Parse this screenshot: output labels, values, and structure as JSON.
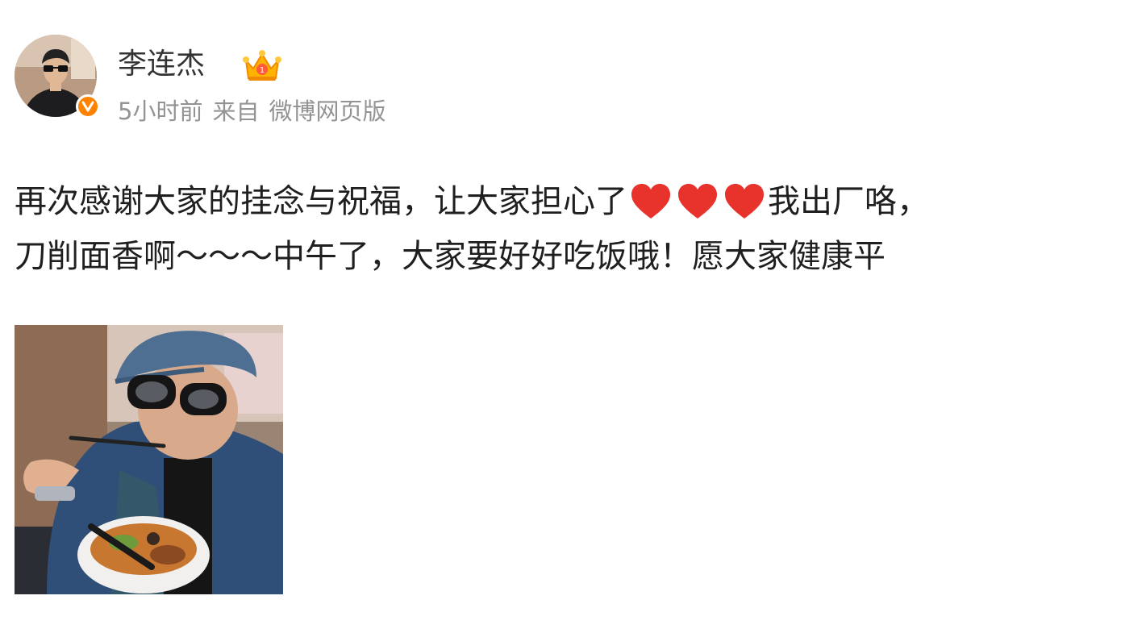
{
  "author": {
    "name": "李连杰",
    "avatar_icon": "avatar-portrait",
    "verified_icon": "verified-badge-icon",
    "badge_icon": "crown-icon",
    "accent_color": "#ff8200"
  },
  "meta": {
    "time": "5小时前",
    "source_prefix": "来自",
    "source": "微博网页版"
  },
  "post": {
    "line1_a": "再次感谢大家的挂念与祝福，让大家担心了",
    "hearts": [
      "❤",
      "❤",
      "❤"
    ],
    "line1_b": "我出厂咯，",
    "line2": "刀削面香啊～～～中午了，大家要好好吃饭哦！愿大家健康平"
  },
  "image": {
    "icon": "photo-man-eating-noodles"
  }
}
